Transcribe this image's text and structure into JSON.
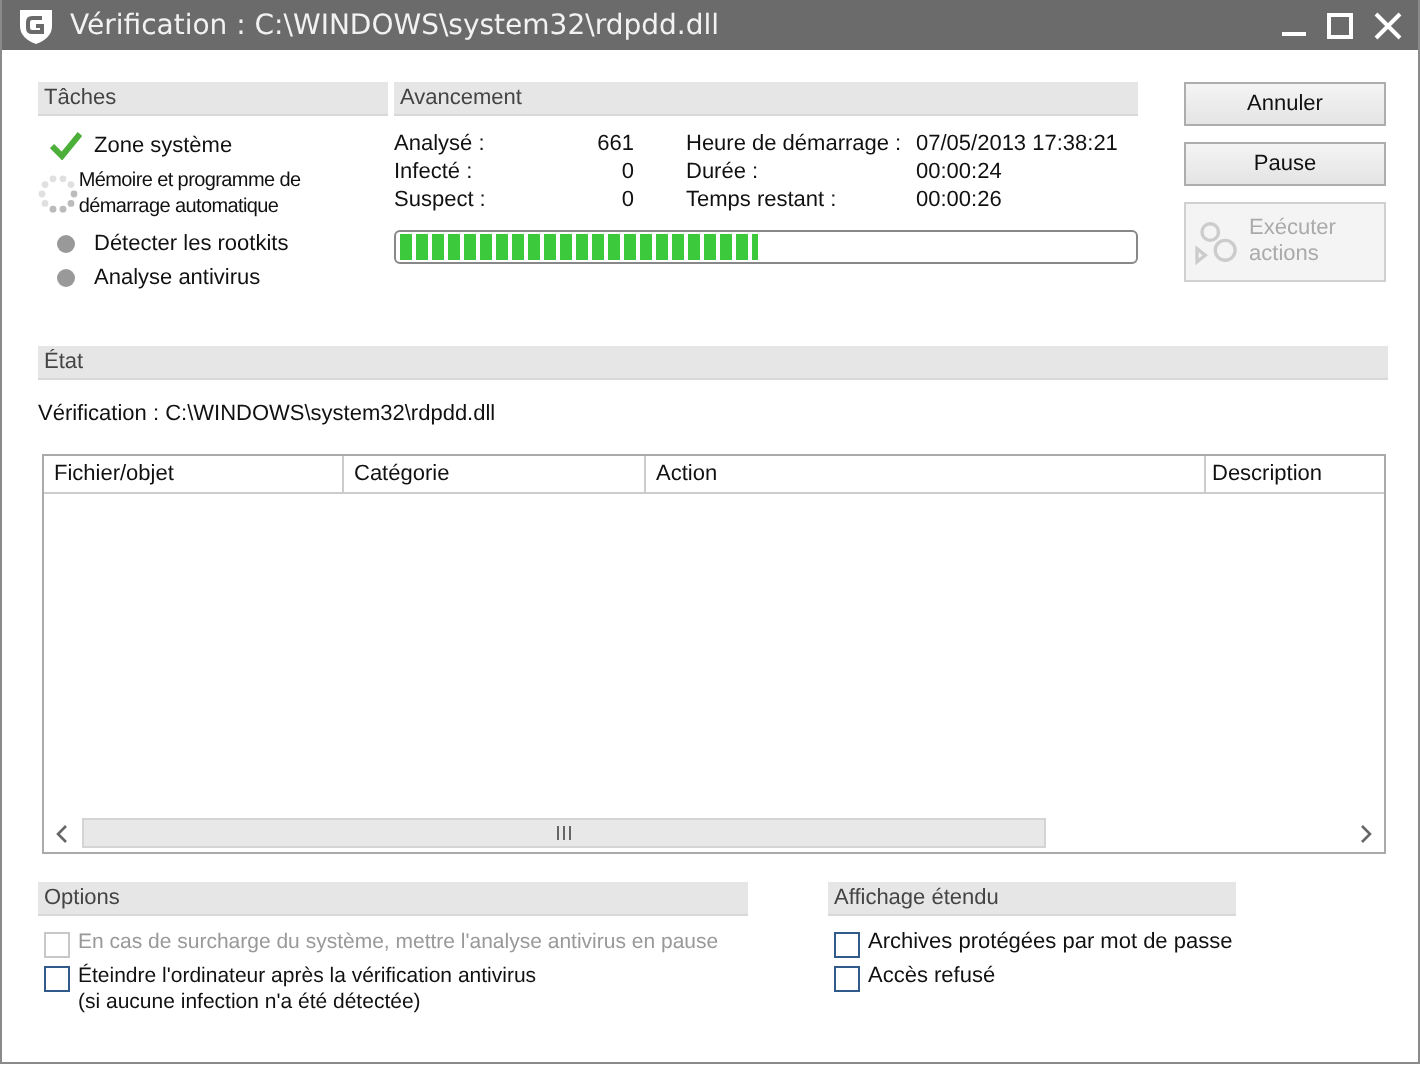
{
  "window": {
    "title": "Vérification : C:\\WINDOWS\\system32\\rdpdd.dll"
  },
  "tasks": {
    "title": "Tâches",
    "items": [
      {
        "label": "Zone système",
        "kind": "done"
      },
      {
        "label": "Mémoire et programme de démarrage automatique",
        "kind": "running"
      },
      {
        "label": "Détecter les rootkits",
        "kind": "pending"
      },
      {
        "label": "Analyse antivirus",
        "kind": "pending"
      }
    ]
  },
  "progress": {
    "title": "Avancement",
    "stats": [
      {
        "label": "Analysé :",
        "value": "661"
      },
      {
        "label": "Heure de démarrage :",
        "value": "07/05/2013 17:38:21"
      },
      {
        "label": "Infecté :",
        "value": "0"
      },
      {
        "label": "Durée :",
        "value": "00:00:24"
      },
      {
        "label": "Suspect :",
        "value": "0"
      },
      {
        "label": "Temps restant :",
        "value": "00:00:26"
      }
    ],
    "level": 0.49
  },
  "buttons": [
    {
      "label": "Annuler",
      "disabled": false,
      "kind": "text"
    },
    {
      "label": "Pause",
      "disabled": false,
      "kind": "text"
    },
    {
      "label": "Exécuter actions",
      "disabled": true,
      "kind": "icon"
    }
  ],
  "state": {
    "title": "État",
    "text": "Vérification : C:\\WINDOWS\\system32\\rdpdd.dll"
  },
  "table": {
    "columns": [
      "Fichier/objet",
      "Catégorie",
      "Action",
      "Description"
    ]
  },
  "options": {
    "title": "Options",
    "items": [
      {
        "label": "En cas de surcharge du système, mettre l'analyse antivirus en pause",
        "checked": false,
        "disabled": true
      },
      {
        "label": "Éteindre l'ordinateur après la vérification antivirus\n(si aucune infection n'a été détectée)",
        "checked": false,
        "disabled": false
      }
    ]
  },
  "extended": {
    "title": "Affichage étendu",
    "items": [
      {
        "label": "Archives protégées par mot de passe",
        "checked": false,
        "disabled": false
      },
      {
        "label": "Accès refusé",
        "checked": false,
        "disabled": false
      }
    ]
  }
}
